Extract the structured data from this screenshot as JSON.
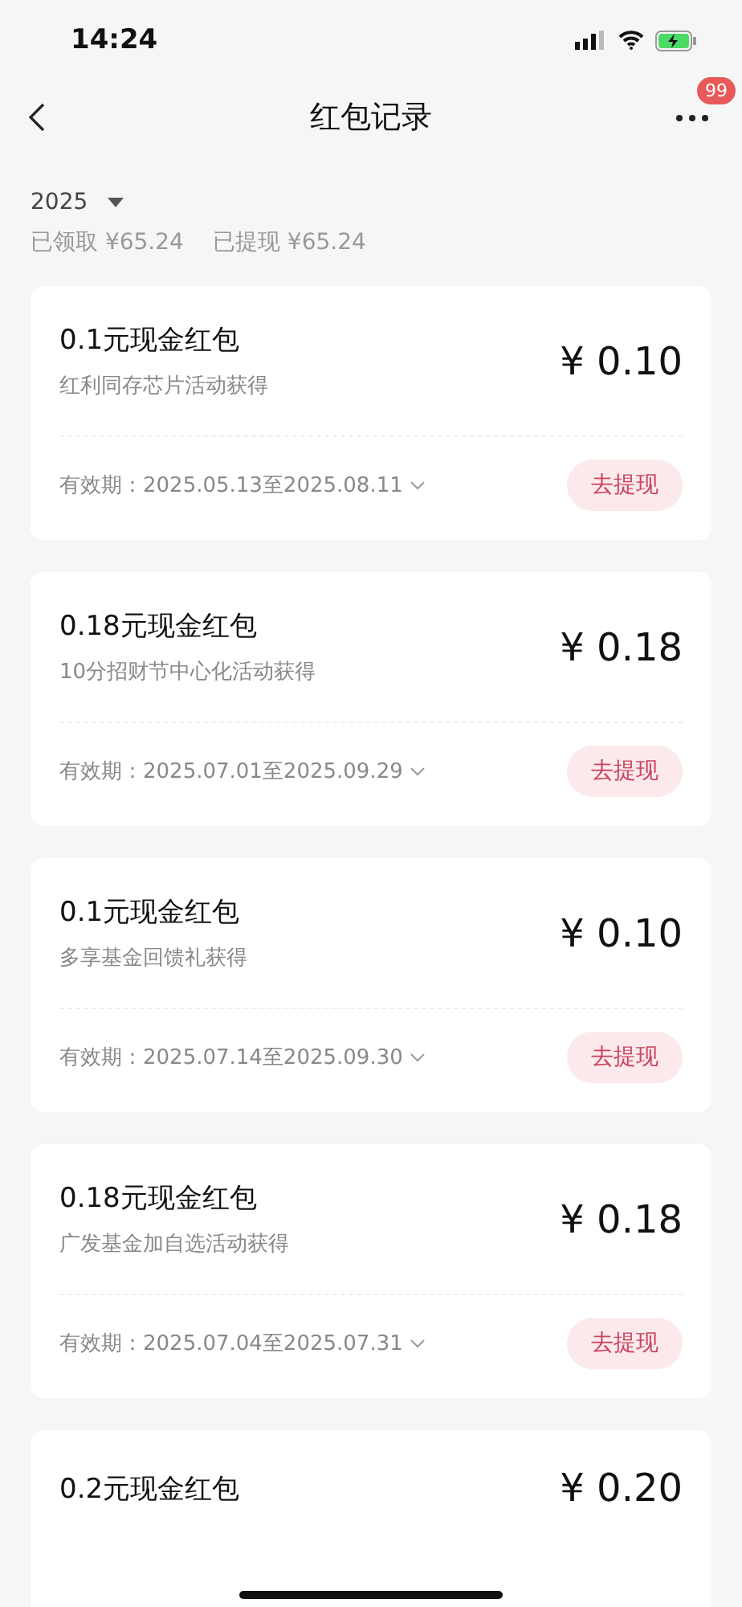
{
  "status_bar": {
    "time": "14:24"
  },
  "header": {
    "title": "红包记录",
    "badge": "99"
  },
  "filter": {
    "year": "2025"
  },
  "summary": [
    {
      "label": "已领取",
      "amount": "¥65.24"
    },
    {
      "label": "已提现",
      "amount": "¥65.24"
    }
  ],
  "cards": [
    {
      "title": "0.1元现金红包",
      "source": "红利同存芯片活动获得",
      "amount": "¥ 0.10",
      "validity": "有效期：2025.05.13至2025.08.11",
      "action": "去提现"
    },
    {
      "title": "0.18元现金红包",
      "source": "10分招财节中心化活动获得",
      "amount": "¥ 0.18",
      "validity": "有效期：2025.07.01至2025.09.29",
      "action": "去提现"
    },
    {
      "title": "0.1元现金红包",
      "source": "多享基金回馈礼获得",
      "amount": "¥ 0.10",
      "validity": "有效期：2025.07.14至2025.09.30",
      "action": "去提现"
    },
    {
      "title": "0.18元现金红包",
      "source": "广发基金加自选活动获得",
      "amount": "¥ 0.18",
      "validity": "有效期：2025.07.04至2025.07.31",
      "action": "去提现"
    },
    {
      "title": "0.2元现金红包",
      "amount": "¥ 0.20"
    }
  ]
}
